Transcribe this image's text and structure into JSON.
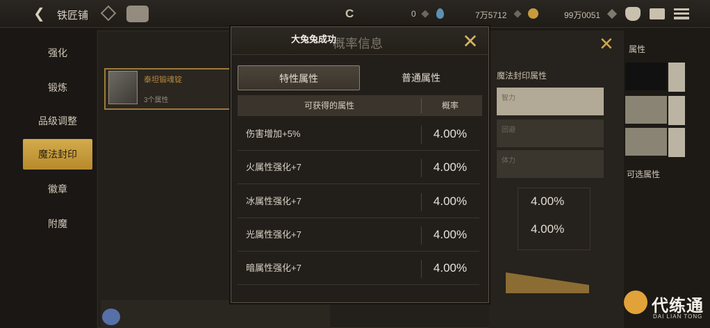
{
  "topbar": {
    "title": "铁匠铺",
    "currency_1": "0",
    "currency_2": "7万5712",
    "currency_3": "99万0051"
  },
  "nav": {
    "items": [
      {
        "label": "强化"
      },
      {
        "label": "锻炼"
      },
      {
        "label": "品级调整"
      },
      {
        "label": "魔法封印"
      },
      {
        "label": "徽章"
      },
      {
        "label": "附魔"
      }
    ],
    "active_index": 3
  },
  "background": {
    "item_name": "泰坦锻魂锭",
    "item_sub": "3个属性",
    "right_title": "魔法封印属性",
    "right_rows": [
      "智力",
      "回避",
      "体力"
    ],
    "right_values": [
      "4.00%",
      "4.00%"
    ],
    "side_label_top": "属性",
    "side_label_mid": "可选属性"
  },
  "modal": {
    "title": "大兔兔成功",
    "title_bg": "概率信息",
    "tabs": [
      {
        "label": "特性属性",
        "active": true
      },
      {
        "label": "普通属性",
        "active": false
      }
    ],
    "table": {
      "headers": [
        "可获得的属性",
        "概率"
      ],
      "rows": [
        {
          "name": "伤害增加+5%",
          "rate": "4.00%"
        },
        {
          "name": "火属性强化+7",
          "rate": "4.00%"
        },
        {
          "name": "冰属性强化+7",
          "rate": "4.00%"
        },
        {
          "name": "光属性强化+7",
          "rate": "4.00%"
        },
        {
          "name": "暗属性强化+7",
          "rate": "4.00%"
        }
      ]
    }
  },
  "watermark": {
    "text": "代练通",
    "sub": "DAI LIAN TONG"
  },
  "colors": {
    "accent_gold": "#c9a652",
    "active_tab": "#d3ab4b"
  }
}
